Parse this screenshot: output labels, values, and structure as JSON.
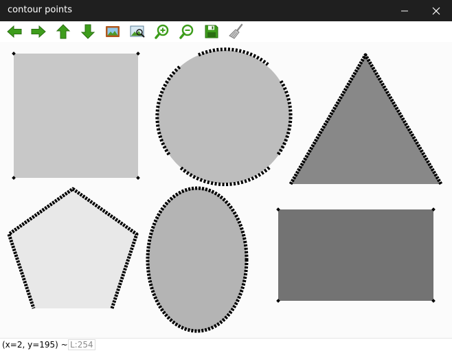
{
  "window": {
    "title": "contour points"
  },
  "toolbar": {
    "buttons": [
      {
        "name": "back-button",
        "icon": "arrow-left-icon"
      },
      {
        "name": "forward-button",
        "icon": "arrow-right-icon"
      },
      {
        "name": "up-button",
        "icon": "arrow-up-icon"
      },
      {
        "name": "down-button",
        "icon": "arrow-down-icon"
      },
      {
        "name": "show-image-button",
        "icon": "picture-icon"
      },
      {
        "name": "zoom-fit-button",
        "icon": "zoom-fit-icon"
      },
      {
        "name": "zoom-in-button",
        "icon": "zoom-in-icon"
      },
      {
        "name": "zoom-out-button",
        "icon": "zoom-out-icon"
      },
      {
        "name": "save-button",
        "icon": "save-icon"
      },
      {
        "name": "clear-button",
        "icon": "brush-icon"
      }
    ]
  },
  "canvas": {
    "shapes": [
      {
        "name": "square",
        "fill": "#c8c8c8"
      },
      {
        "name": "circle",
        "fill": "#bdbdbd"
      },
      {
        "name": "triangle",
        "fill": "#888888"
      },
      {
        "name": "pentagon",
        "fill": "#e8e8e8"
      },
      {
        "name": "ellipse",
        "fill": "#b4b4b4"
      },
      {
        "name": "rectangle",
        "fill": "#737373"
      }
    ]
  },
  "status": {
    "coords": "(x=2, y=195) ~",
    "value": "L:254"
  },
  "colors": {
    "titlebar": "#1f1f1f",
    "icon_green": "#3e9d1c",
    "contour": "#000000"
  }
}
